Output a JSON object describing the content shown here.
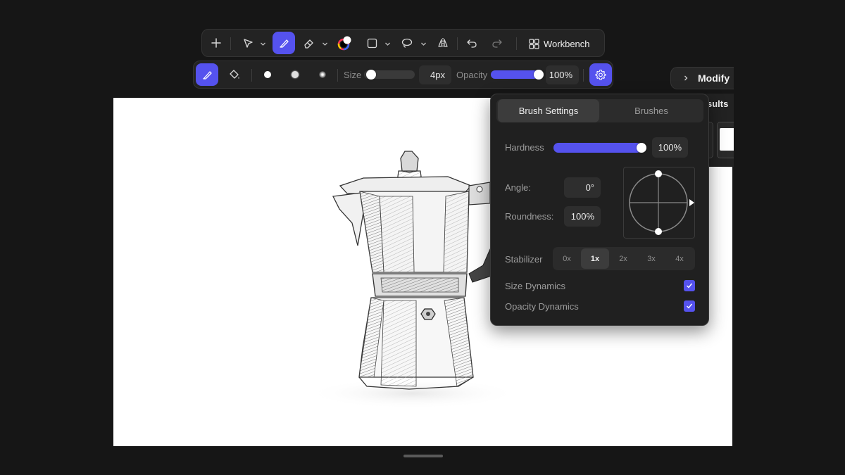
{
  "toolbar": {
    "workbench_label": "Workbench",
    "tools": [
      "add-icon",
      "select-icon",
      "brush-icon",
      "eraser-icon",
      "color-picker-icon",
      "rectangle-icon",
      "lasso-icon",
      "mirror-icon",
      "undo-icon",
      "redo-icon"
    ],
    "accent": "#5552ee"
  },
  "brush_bar": {
    "size_label": "Size",
    "size_value": "4px",
    "size_fraction": 0.05,
    "opacity_label": "Opacity",
    "opacity_value": "100%",
    "opacity_fraction": 1.0
  },
  "popover": {
    "tabs": [
      "Brush Settings",
      "Brushes"
    ],
    "active_tab": "Brush Settings",
    "hardness_label": "Hardness",
    "hardness_value": "100%",
    "hardness_fraction": 1.0,
    "angle_label": "Angle:",
    "angle_value": "0°",
    "roundness_label": "Roundness:",
    "roundness_value": "100%",
    "stabilizer_label": "Stabilizer",
    "stabilizer_options": [
      "0x",
      "1x",
      "2x",
      "3x",
      "4x"
    ],
    "stabilizer_selected": "1x",
    "size_dynamics_label": "Size Dynamics",
    "size_dynamics_checked": true,
    "opacity_dynamics_label": "Opacity Dynamics",
    "opacity_dynamics_checked": true
  },
  "right_panel": {
    "modify_label": "Modify",
    "results_tab_label": "sults"
  }
}
